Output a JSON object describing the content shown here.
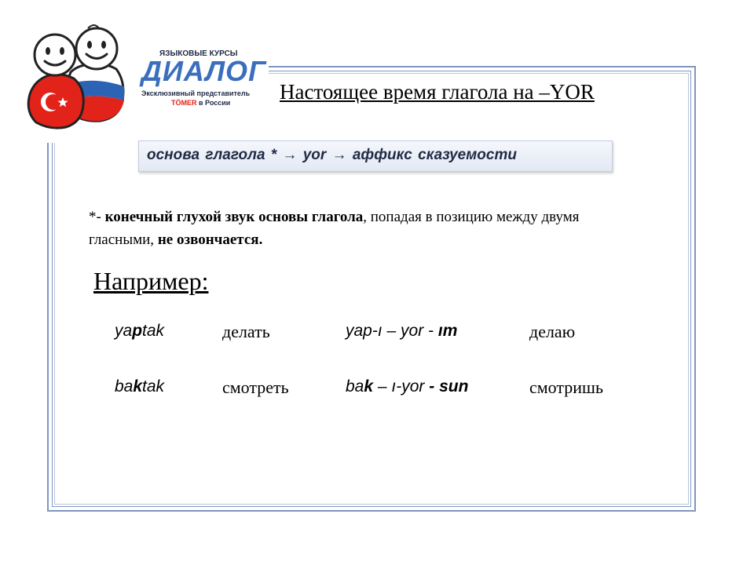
{
  "logo": {
    "line1": "ЯЗЫКОВЫЕ КУРСЫ",
    "brand": "ДИАЛОГ",
    "line3": "Эксклюзивный представитель",
    "line4_highlight": "TÖMER",
    "line4_rest": " в России"
  },
  "title": "Настоящее время глагола на –YOR",
  "formula": "основа глагола * → yor → аффикс сказуемости",
  "note": {
    "prefix": "*- ",
    "bold1": "конечный глухой звук основы глагола",
    "mid": ", попадая в позицию между двумя гласными, ",
    "bold2": "не озвончается."
  },
  "example_heading": "Например:",
  "examples": [
    {
      "verb": [
        "ya",
        "p",
        "tak"
      ],
      "translation": "делать",
      "form": [
        "yap-",
        "ı – yor - ",
        "ım"
      ],
      "form_translation": "делаю"
    },
    {
      "verb": [
        "ba",
        "k",
        "tak"
      ],
      "translation": "смотреть",
      "form": [
        "ba",
        "k",
        " – ı-yor",
        " - sun"
      ],
      "form_translation": "смотришь"
    }
  ],
  "colors": {
    "frame": "#8096be",
    "brand_blue": "#3a6fbd",
    "turkey_red": "#e2231a",
    "russia_blue": "#2c63b5"
  }
}
